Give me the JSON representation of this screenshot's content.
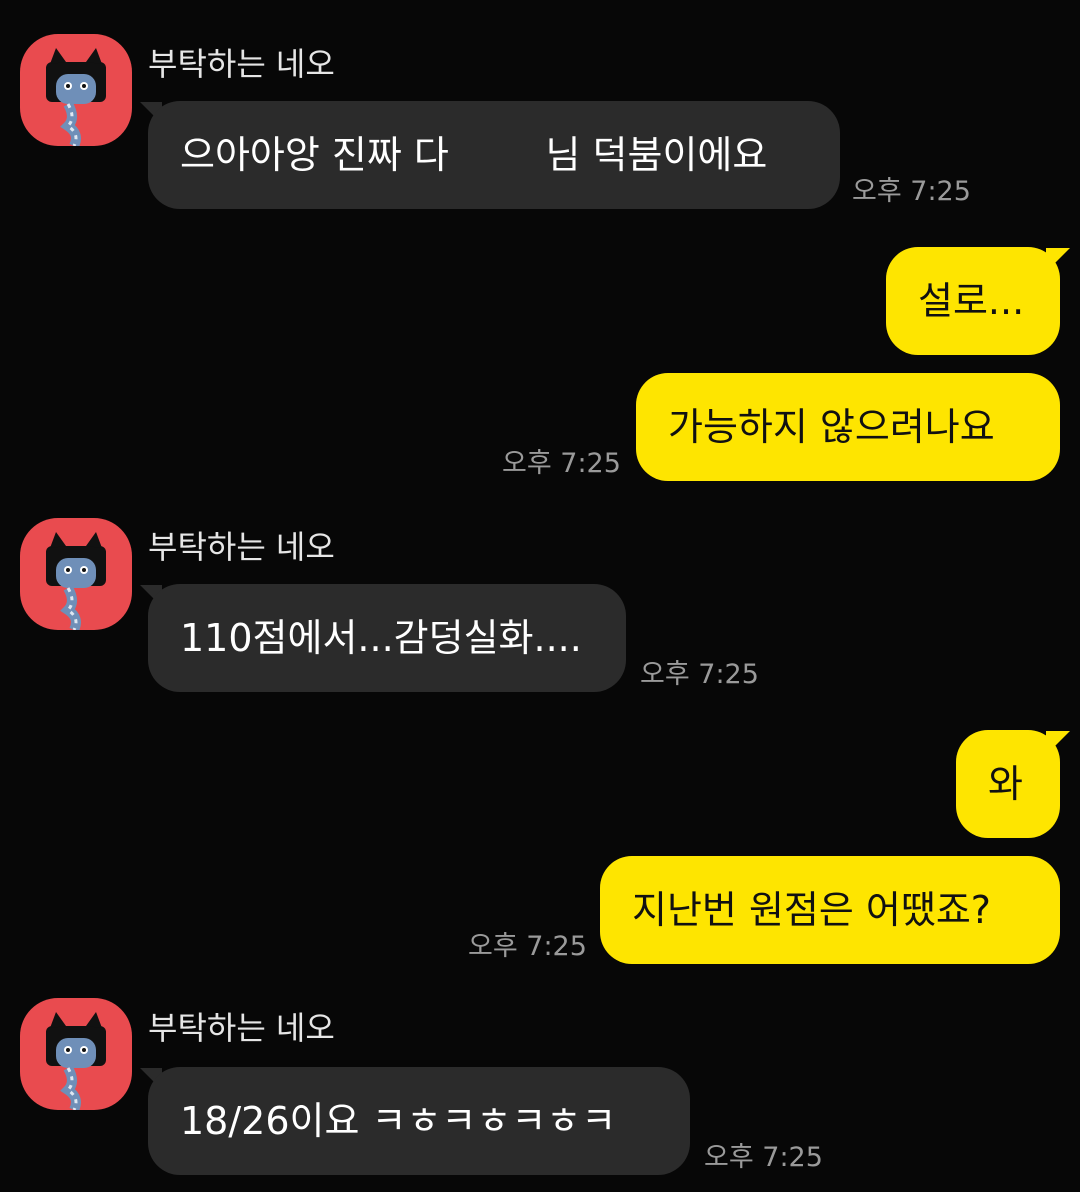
{
  "chat": {
    "partner_name": "부탁하는 네오",
    "avatar_icon": "neo-cat-avatar-icon",
    "colors": {
      "background": "#070707",
      "incoming_bubble": "#2b2b2b",
      "outgoing_bubble": "#fee500",
      "avatar_background": "#e94b4f",
      "timestamp": "#9a9a9a"
    },
    "messages": [
      {
        "direction": "incoming",
        "sender": "부탁하는 네오",
        "text": "으아아앙 진짜 다        님 덕붐이에요",
        "time": "오후 7:25"
      },
      {
        "direction": "outgoing",
        "text": "설로...",
        "time": ""
      },
      {
        "direction": "outgoing",
        "text": "가능하지 않으려나요",
        "time": "오후 7:25"
      },
      {
        "direction": "incoming",
        "sender": "부탁하는 네오",
        "text": "110점에서...감덩실화....",
        "time": "오후 7:25"
      },
      {
        "direction": "outgoing",
        "text": "와",
        "time": ""
      },
      {
        "direction": "outgoing",
        "text": "지난번 원점은 어땠죠?",
        "time": "오후 7:25"
      },
      {
        "direction": "incoming",
        "sender": "부탁하는 네오",
        "text": "18/26이요 ㅋㅎㅋㅎㅋㅎㅋ",
        "time": "오후 7:25"
      }
    ]
  }
}
